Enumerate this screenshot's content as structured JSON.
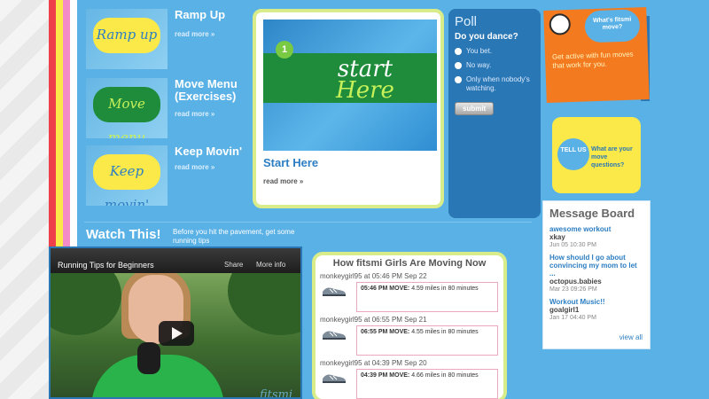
{
  "colors": {
    "page_bg": "#5ab1e6",
    "poll_bg": "#2a77b6",
    "note_orange": "#f47a20",
    "tellus_yellow": "#fbe94a",
    "link_blue": "#2d7ec2",
    "card_border": "#d8ec8a"
  },
  "features": [
    {
      "title": "Ramp Up",
      "more": "read more »",
      "art_text": "Ramp up",
      "art_color": "#fbe94a",
      "art_text_color": "#2d7ec2"
    },
    {
      "title": "Move Menu (Exercises)",
      "more": "read more »",
      "art_text": "Move menu",
      "art_color": "#1e8c3a",
      "art_text_color": "#c6f05a"
    },
    {
      "title": "Keep Movin'",
      "more": "read more »",
      "art_text": "Keep movin'",
      "art_color": "#fbe94a",
      "art_text_color": "#2d7ec2"
    }
  ],
  "start": {
    "step": "1",
    "art_line1": "start",
    "art_line2": "Here",
    "title": "Start Here",
    "more": "read more »"
  },
  "poll": {
    "heading": "Poll",
    "question": "Do you dance?",
    "options": [
      "You bet.",
      "No way.",
      "Only when nobody's watching."
    ],
    "submit": "submit"
  },
  "note": {
    "cloud_text": "What's fitsmi move?",
    "text": "Get active with fun moves that work for you."
  },
  "tellus": {
    "cloud_text": "TELL US",
    "text": "What are your move questions?"
  },
  "message_board": {
    "heading": "Message Board",
    "entries": [
      {
        "title": "awesome workout",
        "user": "xkay",
        "date": "Jun 05 10:30 PM"
      },
      {
        "title": "How should I go about convincing my mom to let ...",
        "user": "octopus.babies",
        "date": "Mar 23 09:26 PM"
      },
      {
        "title": "Workout Music!!",
        "user": "goalgirl1",
        "date": "Jan 17 04:40 PM"
      }
    ],
    "view_all": "view all"
  },
  "watch": {
    "title": "Watch This!",
    "subtitle": "Before you hit the pavement, get some running tips",
    "video_title": "Running Tips for Beginners",
    "share": "Share",
    "more_info": "More info",
    "watermark": "fitsmi move"
  },
  "moving": {
    "heading": "How fitsmi Girls Are Moving Now",
    "entries": [
      {
        "who": "monkeygirl95 at 05:46 PM Sep 22",
        "time": "05:46 PM MOVE:",
        "desc": "4.59 miles in 80 minutes"
      },
      {
        "who": "monkeygirl95 at 06:55 PM Sep 21",
        "time": "06:55 PM MOVE:",
        "desc": "4.55 miles in 80 minutes"
      },
      {
        "who": "monkeygirl95 at 04:39 PM Sep 20",
        "time": "04:39 PM MOVE:",
        "desc": "4.66 miles in 80 minutes"
      }
    ]
  }
}
